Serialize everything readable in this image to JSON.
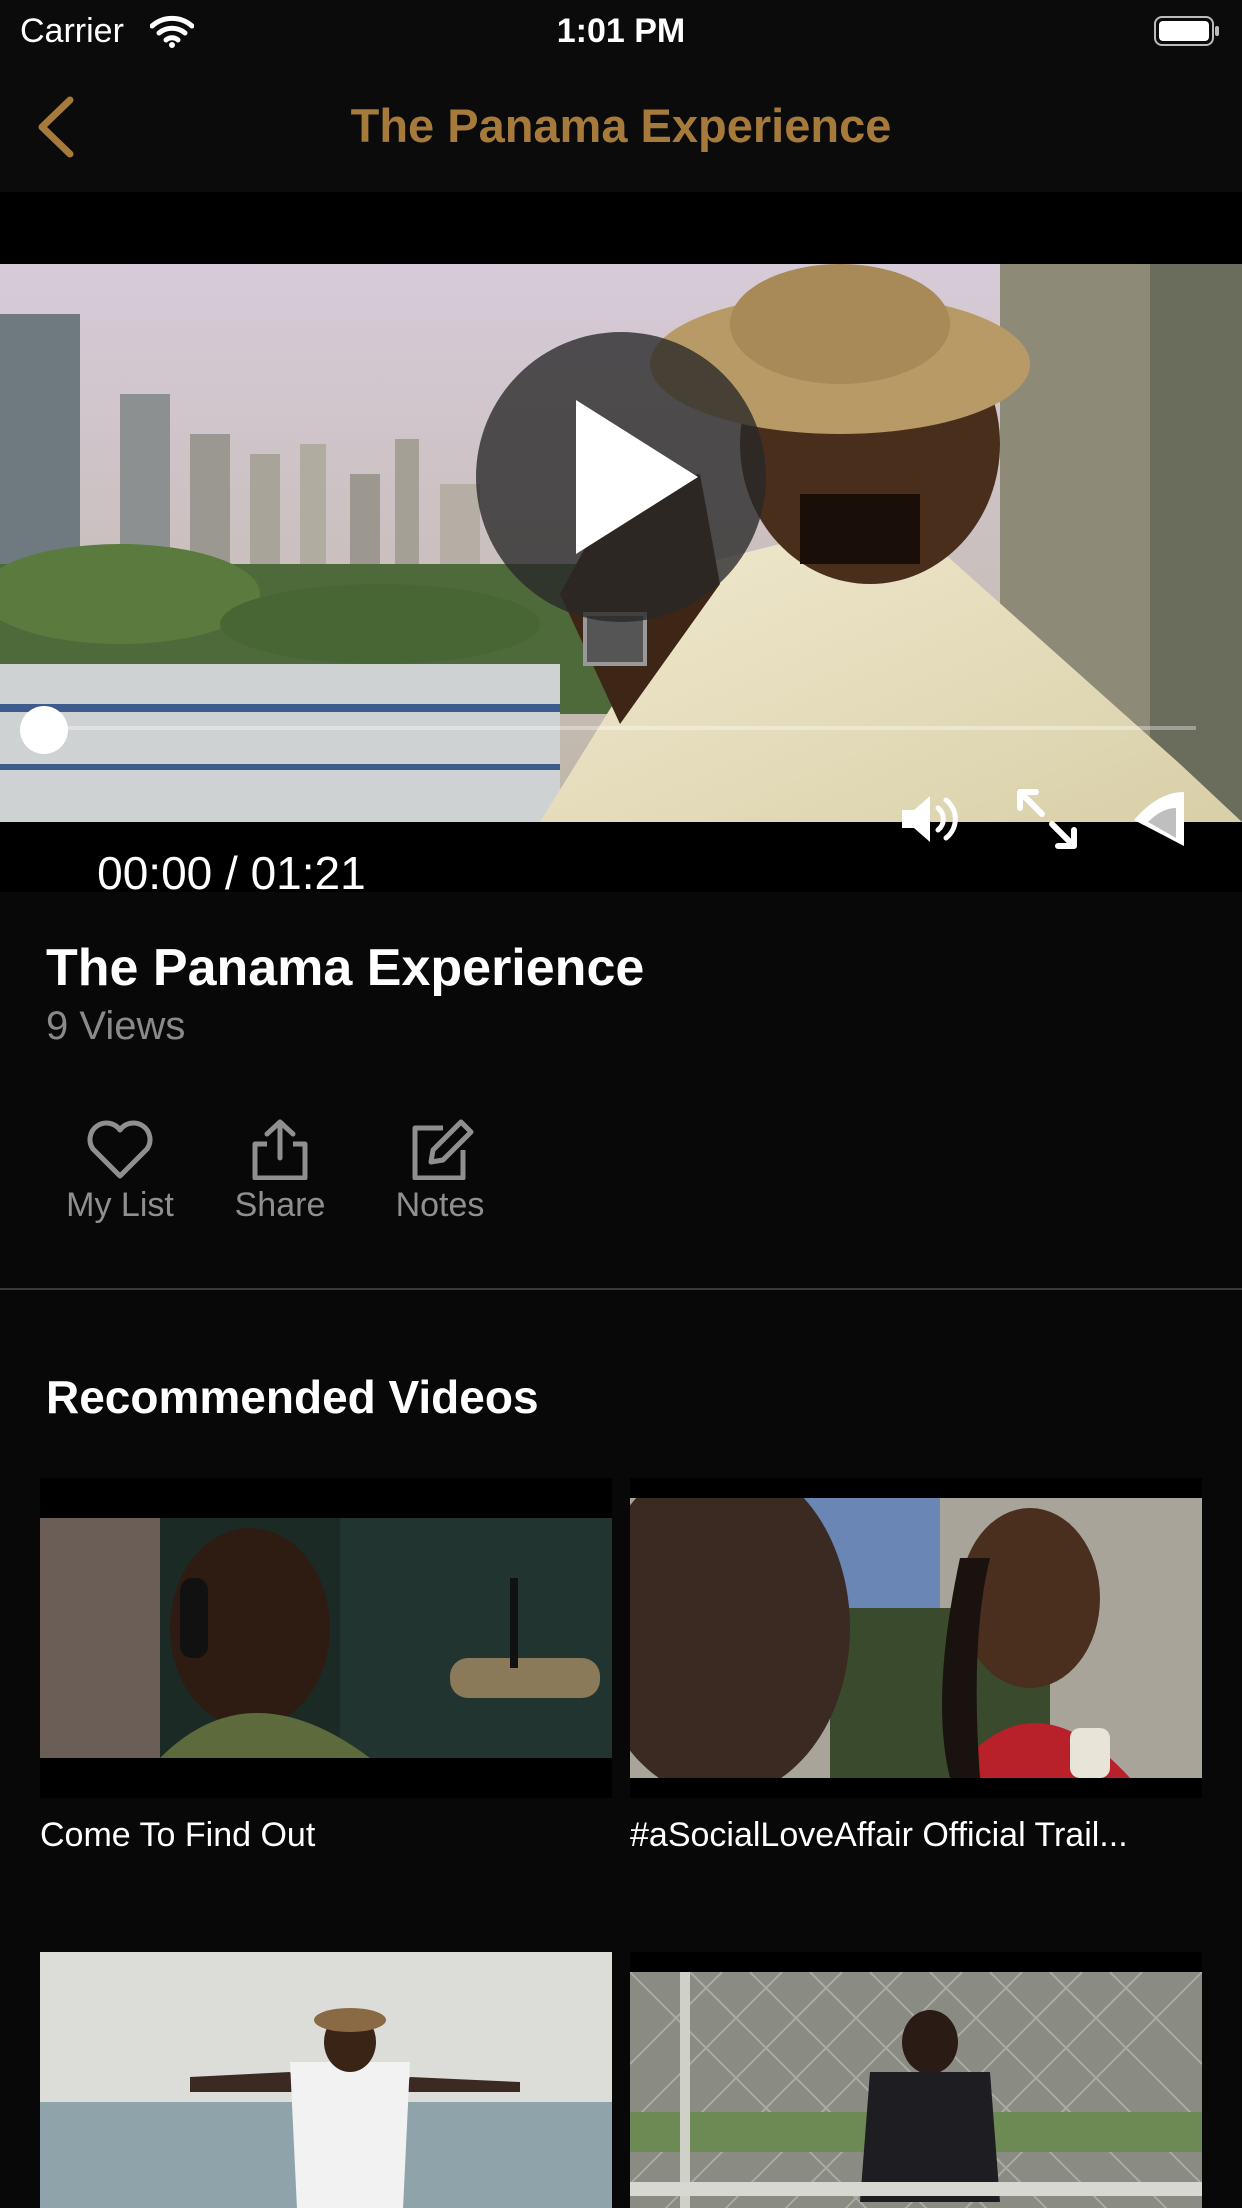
{
  "status_bar": {
    "carrier": "Carrier",
    "time": "1:01 PM"
  },
  "nav": {
    "title": "The Panama Experience",
    "accent_color": "#a67a3a"
  },
  "player": {
    "current_time": "00:00",
    "separator": " / ",
    "duration": "01:21",
    "progress_fraction": 0.0
  },
  "video": {
    "title": "The Panama Experience",
    "views": "9 Views"
  },
  "actions": [
    {
      "label": "My List",
      "icon": "heart-icon"
    },
    {
      "label": "Share",
      "icon": "share-icon"
    },
    {
      "label": "Notes",
      "icon": "edit-icon"
    }
  ],
  "recommended": {
    "title": "Recommended Videos",
    "items": [
      {
        "title": "Come To Find Out"
      },
      {
        "title": "#aSocialLoveAffair Official Trail..."
      },
      {
        "title": ""
      },
      {
        "title": ""
      }
    ]
  }
}
